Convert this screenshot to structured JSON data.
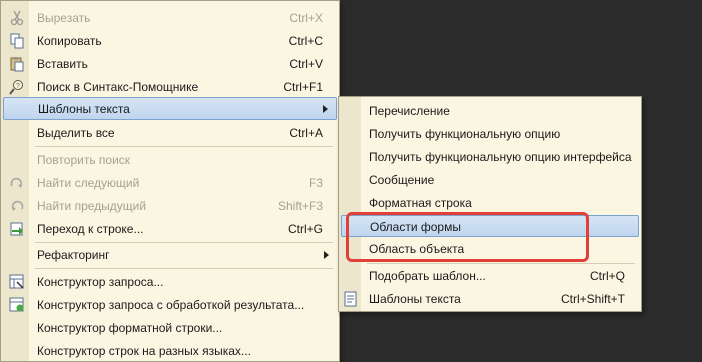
{
  "main_menu": {
    "cut": {
      "label": "Вырезать",
      "shortcut": "Ctrl+X"
    },
    "copy": {
      "label": "Копировать",
      "shortcut": "Ctrl+C"
    },
    "paste": {
      "label": "Вставить",
      "shortcut": "Ctrl+V"
    },
    "syntax_search": {
      "label": "Поиск в Синтакс-Помощнике",
      "shortcut": "Ctrl+F1"
    },
    "text_templates": {
      "label": "Шаблоны текста"
    },
    "select_all": {
      "label": "Выделить все",
      "shortcut": "Ctrl+A"
    },
    "repeat_search": {
      "label": "Повторить поиск"
    },
    "find_next": {
      "label": "Найти следующий",
      "shortcut": "F3"
    },
    "find_prev": {
      "label": "Найти предыдущий",
      "shortcut": "Shift+F3"
    },
    "goto_line": {
      "label": "Переход к строке...",
      "shortcut": "Ctrl+G"
    },
    "refactoring": {
      "label": "Рефакторинг"
    },
    "query_builder": {
      "label": "Конструктор запроса..."
    },
    "query_builder_processing": {
      "label": "Конструктор запроса с обработкой результата..."
    },
    "format_string_builder": {
      "label": "Конструктор форматной строки..."
    },
    "line_builder": {
      "label": "Конструктор строк на разных языках..."
    }
  },
  "sub_menu": {
    "enumeration": {
      "label": "Перечисление"
    },
    "get_functional_option": {
      "label": "Получить функциональную опцию"
    },
    "get_interface_option": {
      "label": "Получить функциональную опцию интерфейса"
    },
    "message": {
      "label": "Сообщение"
    },
    "format_string": {
      "label": "Форматная строка"
    },
    "form_areas": {
      "label": "Области формы"
    },
    "object_area": {
      "label": "Область объекта"
    },
    "pick_template": {
      "label": "Подобрать шаблон...",
      "shortcut": "Ctrl+Q"
    },
    "text_templates": {
      "label": "Шаблоны текста",
      "shortcut": "Ctrl+Shift+T"
    }
  },
  "colors": {
    "menu_bg": "#fbf6e2",
    "highlight": "#c6daf0",
    "annotation": "#e0403a",
    "backdrop": "#2b2b2b"
  }
}
